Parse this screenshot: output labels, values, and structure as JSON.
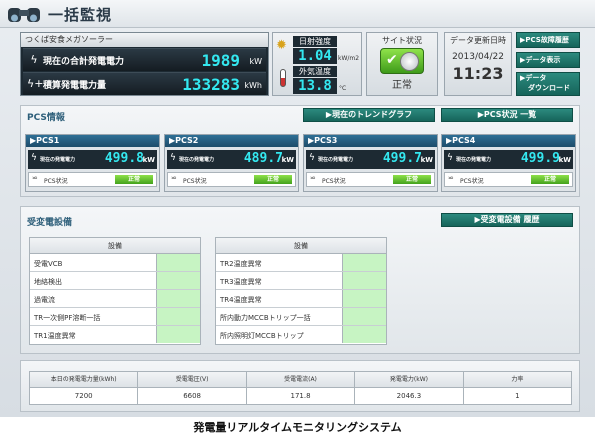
{
  "header": {
    "title": "一括監視",
    "binoculars_icon": "binoculars-icon"
  },
  "plant": {
    "name": "つくば安食メガソーラー",
    "current_power_label": "現在の合計発電電力",
    "current_power_value": "1989",
    "current_power_unit": "kW",
    "total_energy_label": "積算発電電力量",
    "total_energy_value": "133283",
    "total_energy_unit": "kWh"
  },
  "weather": {
    "irradiance_label": "日射強度",
    "irradiance_value": "1.04",
    "irradiance_unit": "kW/m2",
    "temp_label": "外気温度",
    "temp_value": "13.8",
    "temp_unit": "°C"
  },
  "site_status": {
    "label": "サイト状況",
    "value": "正常",
    "ok_color": "#5cc02c"
  },
  "update": {
    "label": "データ更新日時",
    "date": "2013/04/22",
    "time": "11:23"
  },
  "side_buttons": {
    "fault_history": "▶PCS故障履歴",
    "data_display": "▶データ表示",
    "data_download_1": "▶データ",
    "data_download_2": "ダウンロード"
  },
  "pcs_section": {
    "title": "PCS情報",
    "trend_button": "▶現在のトレンドグラフ",
    "status_list_button": "▶PCS状況 一覧",
    "power_label": "現在の発電電力",
    "status_label": "PCS状況",
    "unit": "kW",
    "cards": [
      {
        "name": "▶PCS1",
        "power": "499.8",
        "status": "正常"
      },
      {
        "name": "▶PCS2",
        "power": "489.7",
        "status": "正常"
      },
      {
        "name": "▶PCS3",
        "power": "499.7",
        "status": "正常"
      },
      {
        "name": "▶PCS4",
        "power": "499.9",
        "status": "正常"
      }
    ]
  },
  "substation": {
    "title": "受変電設備",
    "history_button": "▶受変電設備 履歴",
    "left_table": {
      "header": "設備",
      "rows": [
        "受電VCB",
        "地絡検出",
        "過電流",
        "TR一次側PF溶断一括",
        "TR1温度異常"
      ]
    },
    "right_table": {
      "header": "設備",
      "rows": [
        "TR2温度異常",
        "TR3温度異常",
        "TR4温度異常",
        "所内動力MCCBトリップ一括",
        "所内照明灯MCCBトリップ"
      ]
    }
  },
  "summary": {
    "headers": [
      "本日の発電電力量(kWh)",
      "受電電圧(V)",
      "受電電流(A)",
      "発電電力(kW)",
      "力率"
    ],
    "values": [
      "7200",
      "6608",
      "171.8",
      "2046.3",
      "1"
    ]
  },
  "caption": "発電量リアルタイムモニタリングシステム"
}
